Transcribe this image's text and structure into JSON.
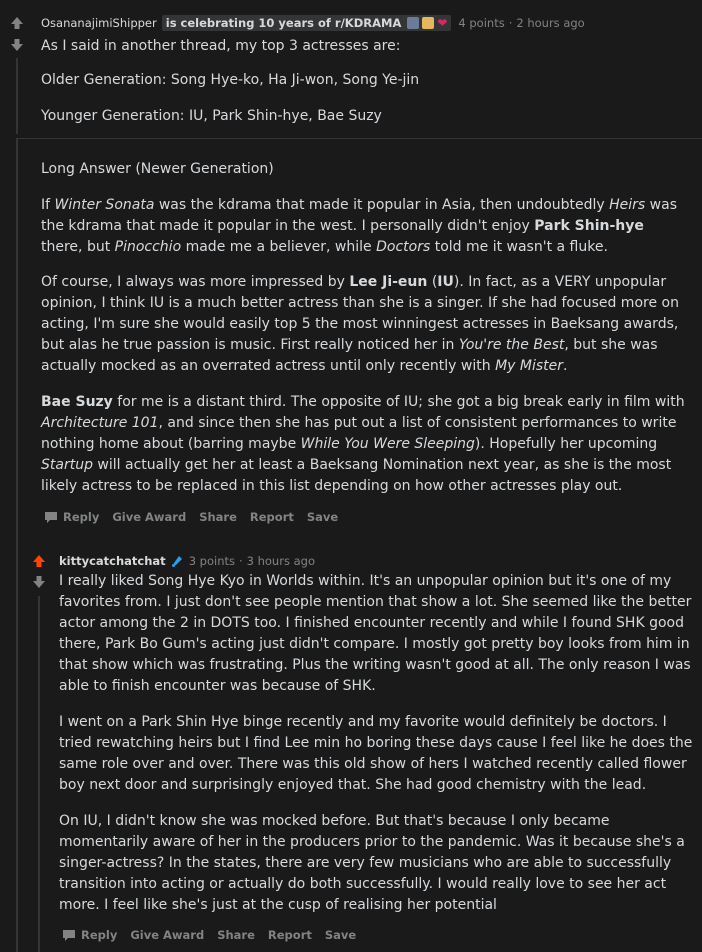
{
  "comment1": {
    "username": "OsananajimiShipper",
    "flair": "is celebrating 10 years of r/KDRAMA",
    "points": "4 points",
    "time": "2 hours ago",
    "p1": "As I said in another thread, my top 3 actresses are:",
    "p2": "Older Generation: Song Hye-ko, Ha Ji-won, Song Ye-jin",
    "p3": "Younger Generation: IU, Park Shin-hye, Bae Suzy"
  },
  "comment2": {
    "p1": "Long Answer (Newer Generation)",
    "p2": {
      "a": "If ",
      "b": "Winter Sonata",
      "c": " was the kdrama that made it popular in Asia, then undoubtedly ",
      "d": "Heirs",
      "e": " was the kdrama that made it popular in the west. I personally didn't enjoy ",
      "f": "Park Shin-hye",
      "g": " there, but ",
      "h": "Pinocchio",
      "i": " made me a believer, while ",
      "j": "Doctors",
      "k": " told me it wasn't a fluke."
    },
    "p3": {
      "a": "Of course, I always was more impressed by ",
      "b": "Lee Ji-eun",
      "c": " (",
      "d": "IU",
      "e": "). In fact, as a VERY unpopular opinion, I think IU is a much better actress than she is a singer. If she had focused more on acting, I'm sure she would easily top 5 the most winningest actresses in Baeksang awards, but alas he true passion is music. First really noticed her in ",
      "f": "You're the Best",
      "g": ", but she was actually mocked as an overrated actress until only recently with ",
      "h": "My Mister",
      "i": "."
    },
    "p4": {
      "a": "Bae Suzy",
      "b": " for me is a distant third. The opposite of IU; she got a big break early in film with ",
      "c": "Architecture 101",
      "d": ", and since then she has put out a list of consistent performances to write nothing home about (barring maybe ",
      "e": "While You Were Sleeping",
      "f": "). Hopefully her upcoming ",
      "g": "Startup",
      "h": " will actually get her at least a Baeksang Nomination next year, as she is the most likely actress to be replaced in this list depending on how other actresses play out."
    },
    "actions": [
      "Reply",
      "Give Award",
      "Share",
      "Report",
      "Save"
    ]
  },
  "comment3": {
    "username": "kittycatchatchat",
    "points": "3 points",
    "time": "3 hours ago",
    "p1": "I really liked Song Hye Kyo in Worlds within. It's an unpopular opinion but it's one of my favorites from. I just don't see people mention that show a lot. She seemed like the better actor among the 2 in DOTS too. I finished encounter recently and while I found SHK good there, Park Bo Gum's acting just didn't compare. I mostly got pretty boy looks from him in that show which was frustrating. Plus the writing wasn't good at all. The only reason I was able to finish encounter was because of SHK.",
    "p2": "I went on a Park Shin Hye binge recently and my favorite would definitely be doctors. I tried rewatching heirs but I find Lee min ho boring these days cause I feel like he does the same role over and over. There was this old show of hers I watched recently called flower boy next door and surprisingly enjoyed that. She had good chemistry with the lead.",
    "p3": "On IU, I didn't know she was mocked before. But that's because I only became momentarily aware of her in the producers prior to the pandemic. Was it because she's a singer-actress? In the states, there are very few musicians who are able to successfully transition into acting or actually do both successfully. I would really love to see her act more. I feel like she's just at the cusp of realising her potential",
    "actions": [
      "Reply",
      "Give Award",
      "Share",
      "Report",
      "Save"
    ]
  },
  "colors": {
    "upvote_active": "#ff4500",
    "vote_inactive": "#818384",
    "thread_line": "#343536",
    "background": "#1a1a1b"
  },
  "icons": [
    "upvote-arrow-icon",
    "downvote-arrow-icon",
    "comment-bubble-icon",
    "award-emoji-icons",
    "blue-flair-icon"
  ]
}
